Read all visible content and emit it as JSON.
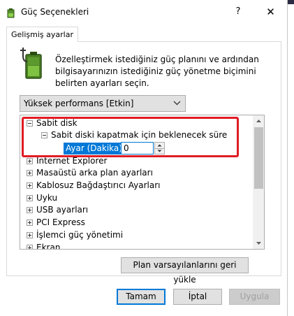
{
  "window": {
    "title": "Güç Seçenekleri",
    "help_label": "?",
    "close_label": "✕"
  },
  "tabs": [
    {
      "label": "Gelişmiş ayarlar"
    }
  ],
  "description": "Özelleştirmek istediğiniz güç planını ve ardından bilgisayarınızın istediğiniz güç yönetme biçimini belirten ayarları seçin.",
  "plan_select": {
    "value": "Yüksek performans [Etkin]"
  },
  "tree": {
    "items": [
      {
        "label": "Sabit disk",
        "expanded": true
      },
      {
        "label": "Sabit diski kapatmak için beklenecek süre",
        "expanded": true
      },
      {
        "label": "Internet Explorer",
        "expanded": false
      },
      {
        "label": "Masaüstü arka plan ayarları",
        "expanded": false
      },
      {
        "label": "Kablosuz Bağdaştırıcı Ayarları",
        "expanded": false
      },
      {
        "label": "Uyku",
        "expanded": false
      },
      {
        "label": "USB ayarları",
        "expanded": false
      },
      {
        "label": "PCI Express",
        "expanded": false
      },
      {
        "label": "İşlemci güç yönetimi",
        "expanded": false
      },
      {
        "label": "Ekran",
        "expanded": false
      }
    ],
    "setting": {
      "label": "Ayar (Dakika):",
      "value": "0"
    }
  },
  "buttons": {
    "restore": "Plan varsayılanlarını geri yükle",
    "ok": "Tamam",
    "cancel": "İptal",
    "apply": "Uygula"
  },
  "colors": {
    "accent": "#0078d7",
    "highlight_border": "#e01b24"
  },
  "icons": {
    "app": "power-options-icon",
    "battery": "battery-plug-icon",
    "chevron": "chevron-down-icon",
    "expander_open": "tree-collapse-icon",
    "expander_closed": "tree-expand-icon"
  }
}
